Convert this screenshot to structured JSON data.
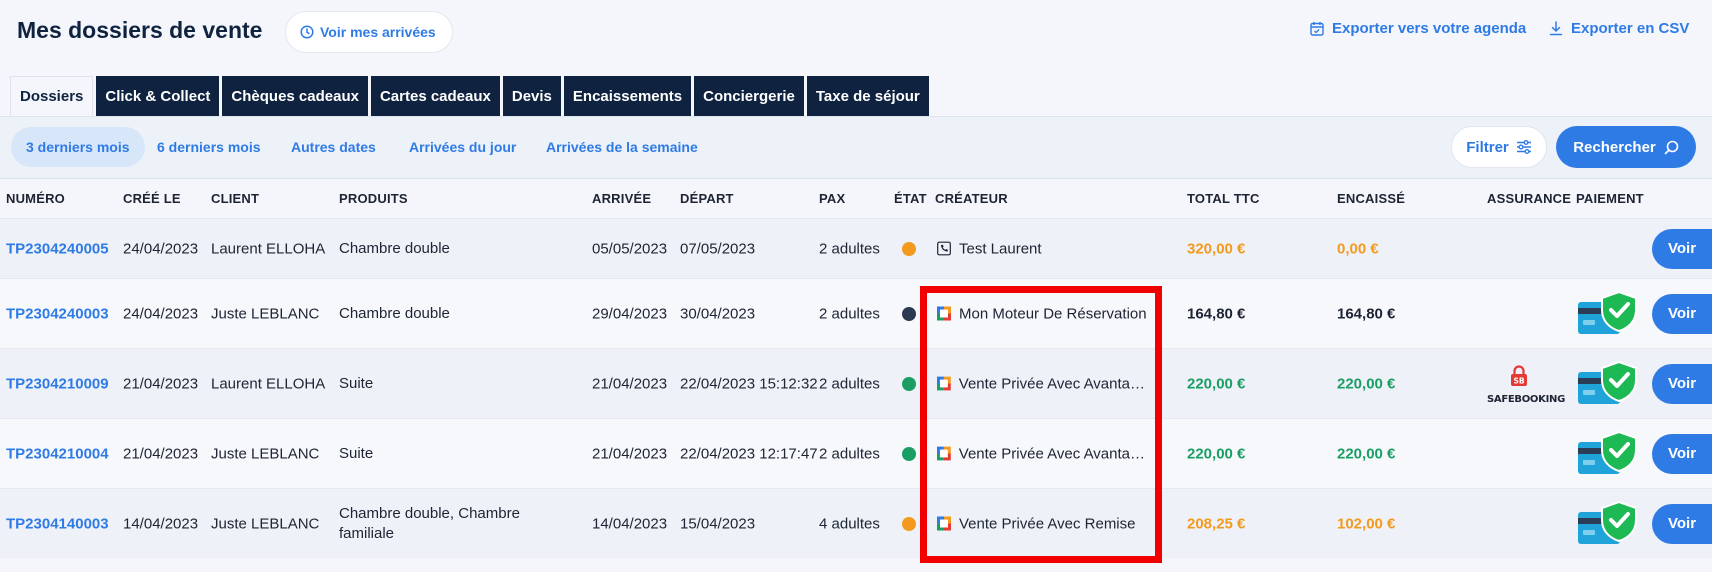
{
  "header": {
    "title": "Mes dossiers de vente",
    "arrivals_button": "Voir mes arrivées",
    "export_agenda": "Exporter vers votre agenda",
    "export_csv": "Exporter en CSV"
  },
  "tabs": [
    "Dossiers",
    "Click & Collect",
    "Chèques cadeaux",
    "Cartes cadeaux",
    "Devis",
    "Encaissements",
    "Conciergerie",
    "Taxe de séjour"
  ],
  "filters": {
    "periods": [
      "3 derniers mois",
      "6 derniers mois",
      "Autres dates",
      "Arrivées du jour",
      "Arrivées de la semaine"
    ],
    "filter_button": "Filtrer",
    "search_button": "Rechercher"
  },
  "table": {
    "columns": {
      "numero": "NUMÉRO",
      "cree_le": "CRÉÉ LE",
      "client": "CLIENT",
      "produits": "PRODUITS",
      "arrivee": "ARRIVÉE",
      "depart": "DÉPART",
      "pax": "PAX",
      "etat": "ÉTAT",
      "createur": "CRÉATEUR",
      "total": "TOTAL TTC",
      "encaisse": "ENCAISSÉ",
      "assurance": "ASSURANCE",
      "paiement": "PAIEMENT"
    },
    "view_label": "Voir",
    "insurance_label": "SAFEBOOKING",
    "insurance_badge": "SB",
    "rows": [
      {
        "numero": "TP2304240005",
        "cree_le": "24/04/2023",
        "client": "Laurent ELLOHA",
        "produits": "Chambre double",
        "arrivee": "05/05/2023",
        "depart": "07/05/2023",
        "pax": "2 adultes",
        "etat_color": "#f39a1e",
        "createur": "Test Laurent",
        "createur_icon": "phone-icon",
        "total": "320,00 €",
        "encaisse": "0,00 €",
        "amount_color": "orange",
        "assurance": false,
        "paiement": false
      },
      {
        "numero": "TP2304240003",
        "cree_le": "24/04/2023",
        "client": "Juste LEBLANC",
        "produits": "Chambre double",
        "arrivee": "29/04/2023",
        "depart": "30/04/2023",
        "pax": "2 adultes",
        "etat_color": "#2b3a52",
        "createur": "Mon Moteur De Réservation",
        "createur_icon": "engine-icon",
        "total": "164,80 €",
        "encaisse": "164,80 €",
        "amount_color": "dark",
        "assurance": false,
        "paiement": true
      },
      {
        "numero": "TP2304210009",
        "cree_le": "21/04/2023",
        "client": "Laurent ELLOHA",
        "produits": "Suite",
        "arrivee": "21/04/2023",
        "depart": "22/04/2023 15:12:32",
        "pax": "2 adultes",
        "etat_color": "#1a9e63",
        "createur": "Vente Privée Avec Avantages",
        "createur_icon": "engine-icon",
        "total": "220,00 €",
        "encaisse": "220,00 €",
        "amount_color": "green",
        "assurance": true,
        "paiement": true
      },
      {
        "numero": "TP2304210004",
        "cree_le": "21/04/2023",
        "client": "Juste LEBLANC",
        "produits": "Suite",
        "arrivee": "21/04/2023",
        "depart": "22/04/2023 12:17:47",
        "pax": "2 adultes",
        "etat_color": "#1a9e63",
        "createur": "Vente Privée Avec Avantages",
        "createur_icon": "engine-icon",
        "total": "220,00 €",
        "encaisse": "220,00 €",
        "amount_color": "green",
        "assurance": false,
        "paiement": true
      },
      {
        "numero": "TP2304140003",
        "cree_le": "14/04/2023",
        "client": "Juste LEBLANC",
        "produits": "Chambre double, Chambre familiale",
        "arrivee": "14/04/2023",
        "depart": "15/04/2023",
        "pax": "4 adultes",
        "etat_color": "#f39a1e",
        "createur": "Vente Privée Avec Remise",
        "createur_icon": "engine-icon",
        "total": "208,25 €",
        "encaisse": "102,00 €",
        "amount_color": "orange",
        "assurance": false,
        "paiement": true
      }
    ]
  },
  "colors": {
    "accent": "#2f7be6",
    "navy": "#0f2340",
    "highlight": "#f20000"
  }
}
